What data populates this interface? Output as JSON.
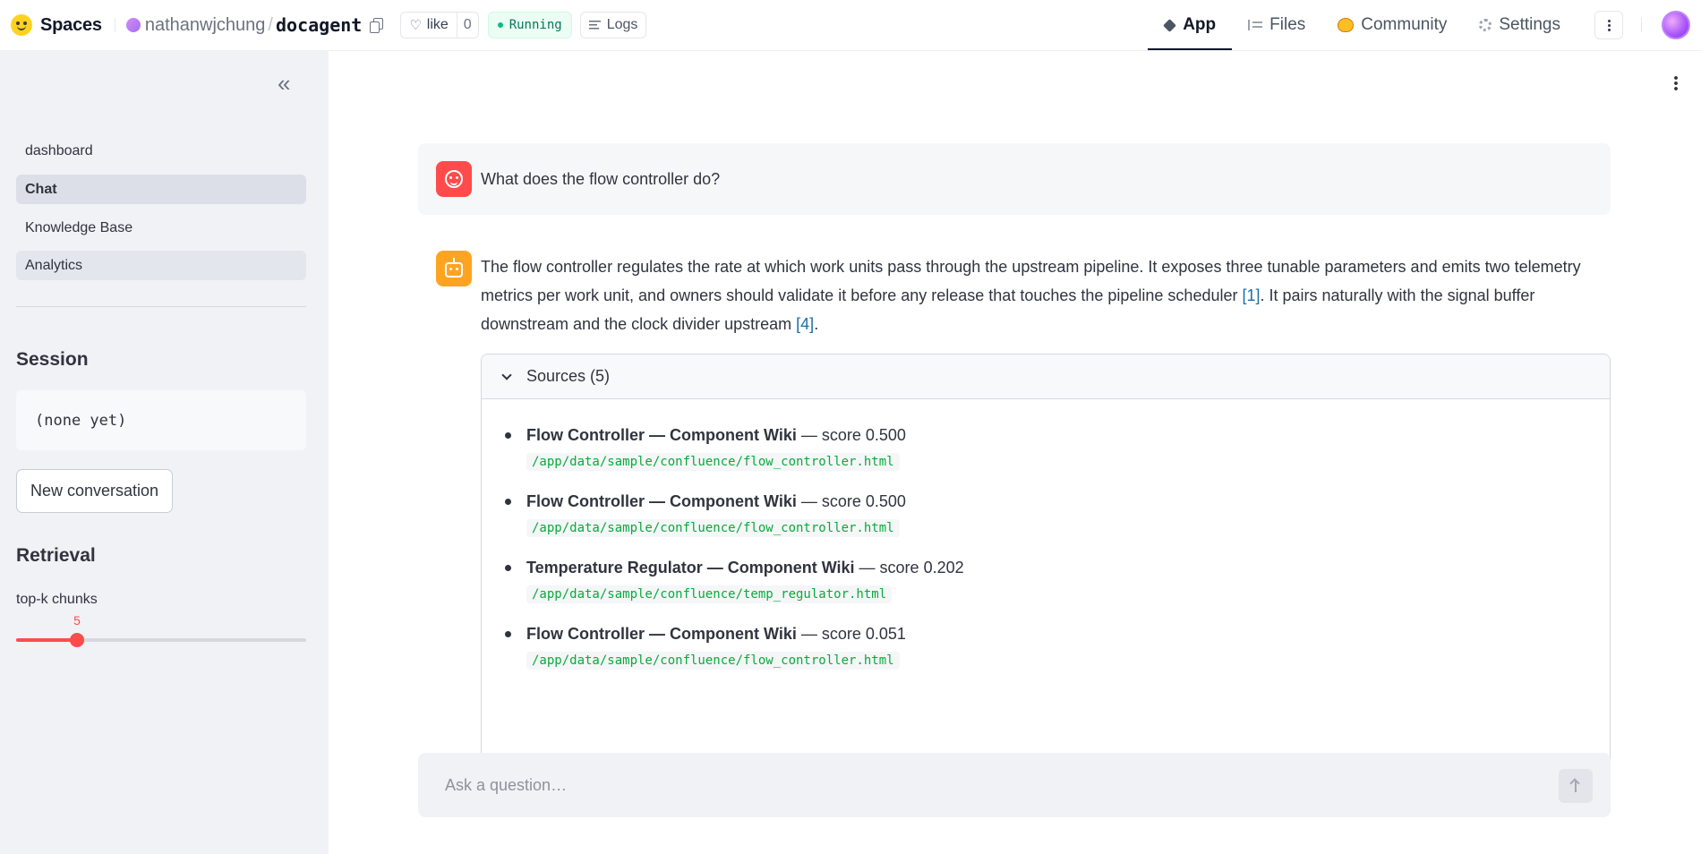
{
  "header": {
    "brand": "Spaces",
    "owner": "nathanwjchung",
    "separator": "/",
    "repo": "docagent",
    "like_label": "like",
    "like_count": "0",
    "status": "Running",
    "logs_label": "Logs",
    "tabs": [
      {
        "label": "App",
        "icon": "cube-icon",
        "active": true
      },
      {
        "label": "Files",
        "icon": "files-icon",
        "active": false
      },
      {
        "label": "Community",
        "icon": "community-icon",
        "active": false
      },
      {
        "label": "Settings",
        "icon": "gear-icon",
        "active": false
      }
    ]
  },
  "sidebar": {
    "collapse_icon": "«",
    "nav": [
      {
        "label": "dashboard"
      },
      {
        "label": "Chat",
        "active": true
      },
      {
        "label": "Knowledge Base"
      },
      {
        "label": "Analytics"
      }
    ],
    "session_heading": "Session",
    "session_value": "(none yet)",
    "new_conversation_label": "New conversation",
    "retrieval_heading": "Retrieval",
    "slider": {
      "label": "top-k chunks",
      "value": "5",
      "min": 1,
      "max": 20
    }
  },
  "chat": {
    "user_message": "What does the flow controller do?",
    "assistant_message": {
      "part1": "The flow controller regulates the rate at which work units pass through the upstream pipeline. It exposes three tunable parameters and emits two telemetry metrics per work unit, and owners should validate it before any release that touches the pipeline scheduler ",
      "cite1": "[1]",
      "part2": ". It pairs naturally with the signal buffer downstream and the clock divider upstream ",
      "cite2": "[4]",
      "part3": "."
    },
    "sources_label": "Sources (5)",
    "sources": [
      {
        "title": "Flow Controller — Component Wiki",
        "score": " — score 0.500",
        "path": "/app/data/sample/confluence/flow_controller.html"
      },
      {
        "title": "Flow Controller — Component Wiki",
        "score": " — score 0.500",
        "path": "/app/data/sample/confluence/flow_controller.html"
      },
      {
        "title": "Temperature Regulator — Component Wiki",
        "score": " — score 0.202",
        "path": "/app/data/sample/confluence/temp_regulator.html"
      },
      {
        "title": "Flow Controller — Component Wiki",
        "score": " — score 0.051",
        "path": "/app/data/sample/confluence/flow_controller.html"
      }
    ],
    "input_placeholder": "Ask a question…"
  },
  "colors": {
    "accent": "#ff4b4b",
    "bot_avatar": "#ffa421",
    "status_green": "#047857",
    "path_green": "#09ab3b"
  }
}
